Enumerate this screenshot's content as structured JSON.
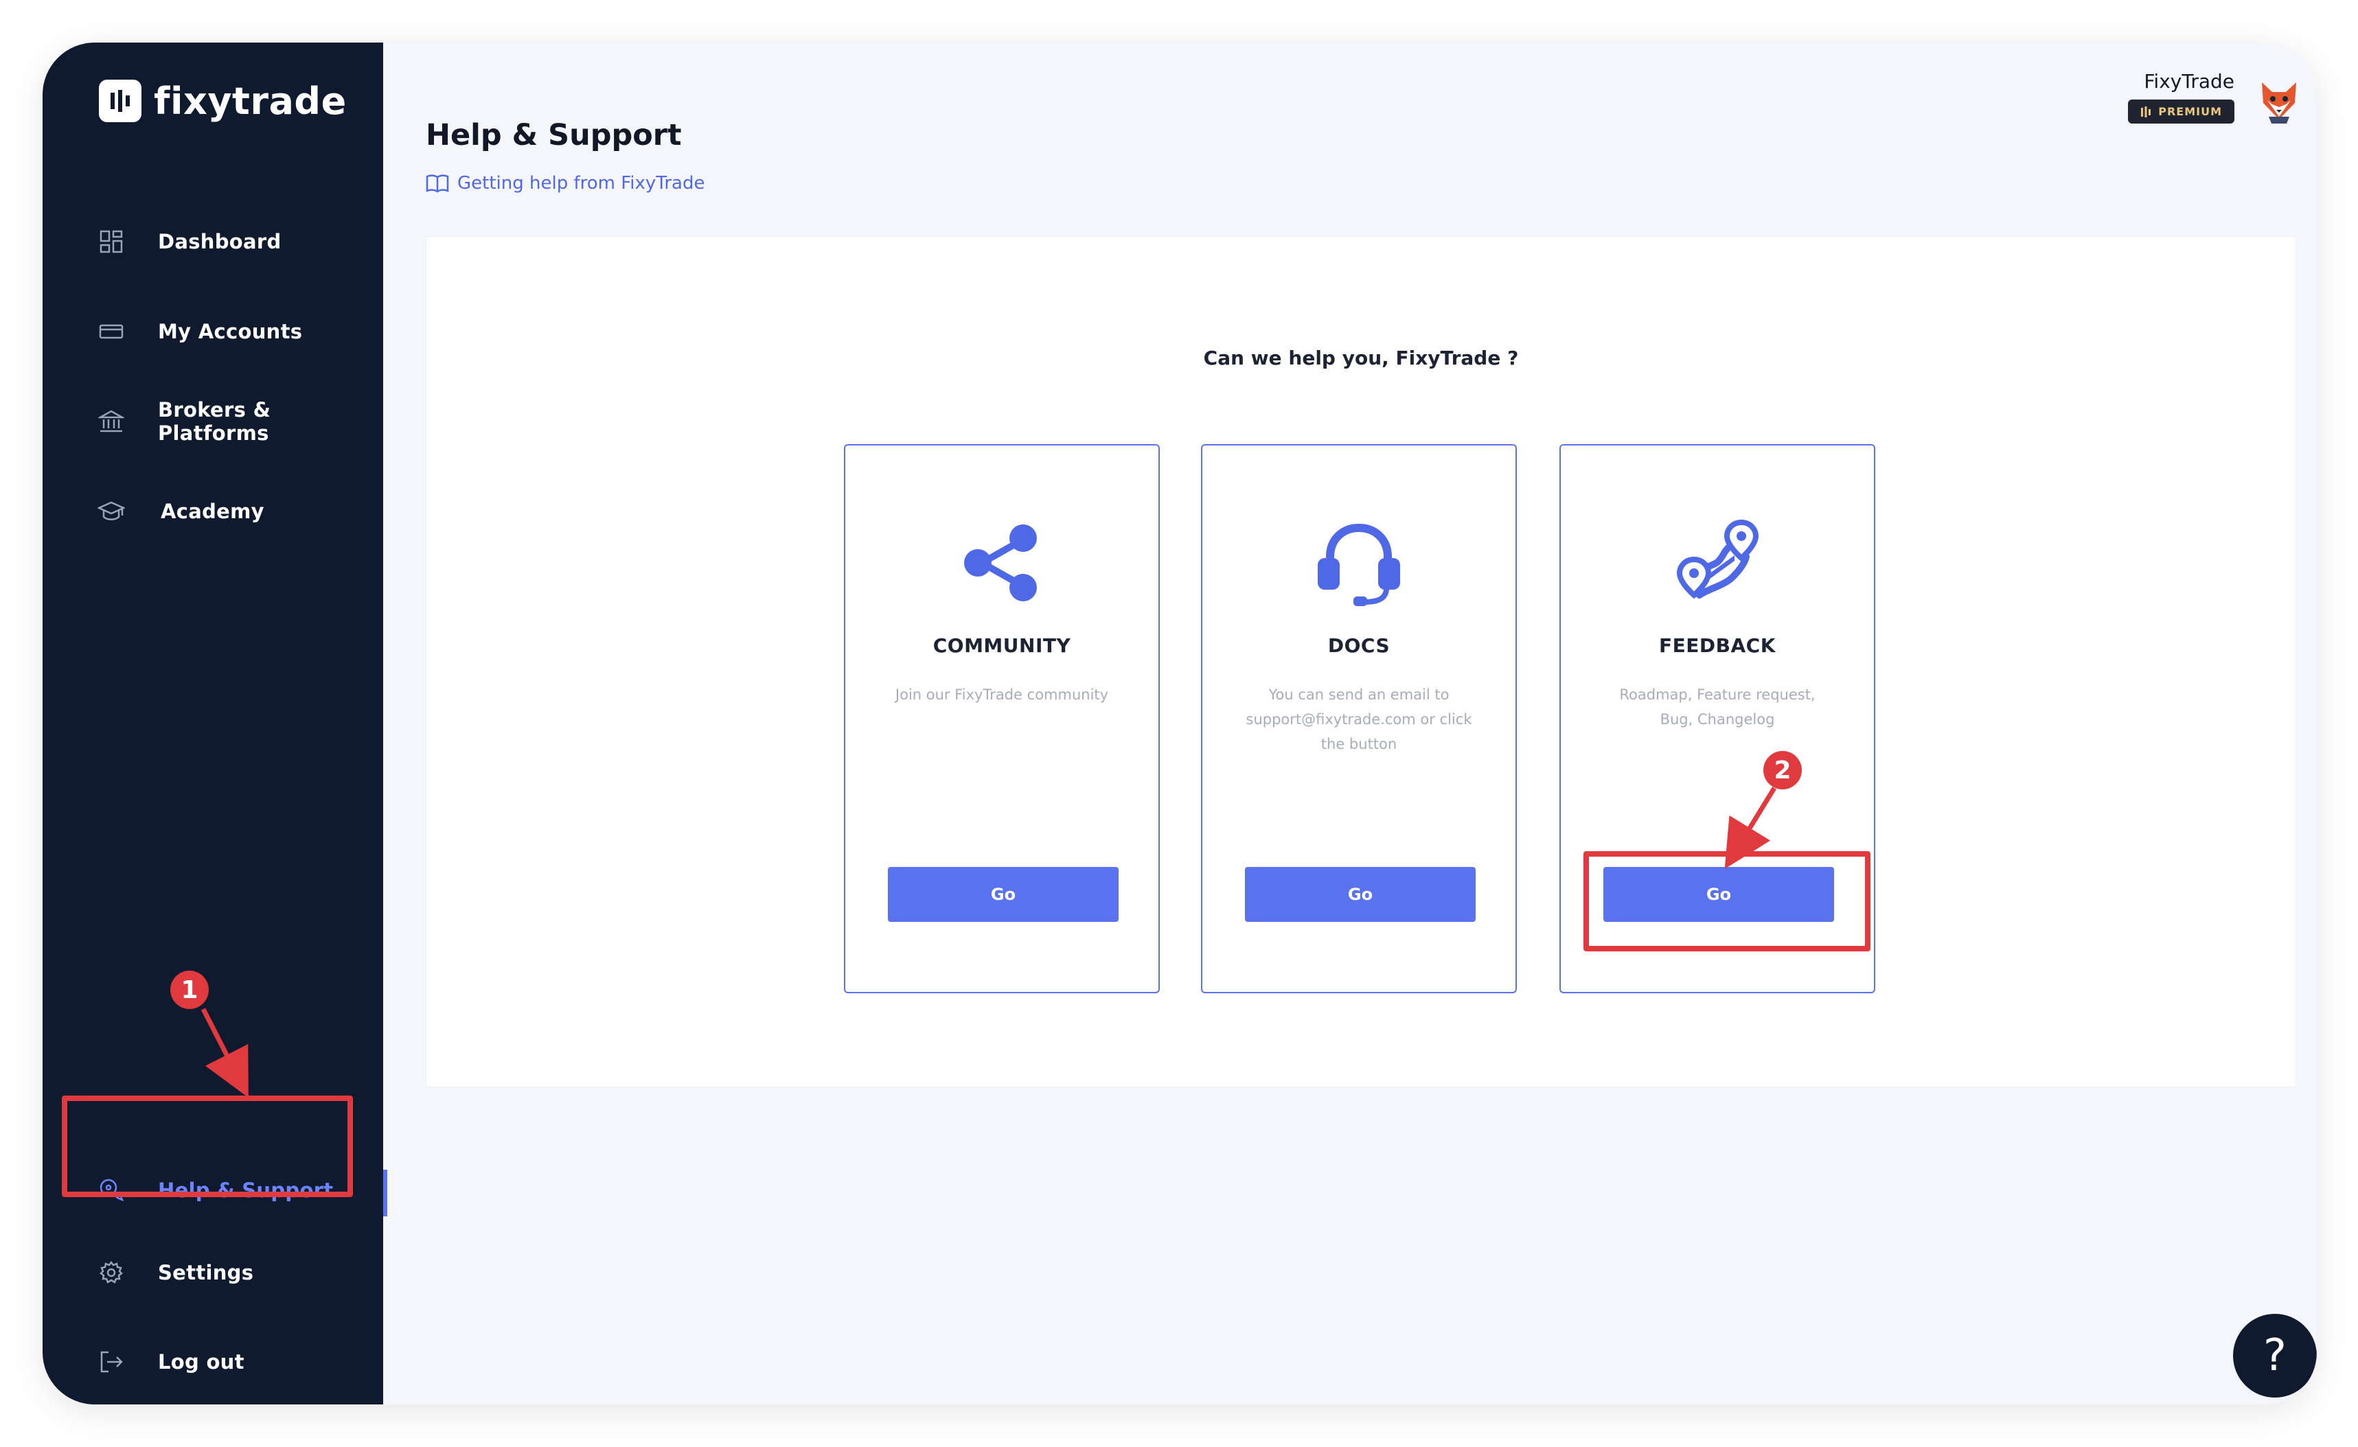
{
  "brand": {
    "name": "fixytrade"
  },
  "sidebar": {
    "items": [
      {
        "label": "Dashboard"
      },
      {
        "label": "My Accounts"
      },
      {
        "label": "Brokers & Platforms"
      },
      {
        "label": "Academy"
      },
      {
        "label": "Help & Support"
      },
      {
        "label": "Settings"
      },
      {
        "label": "Log out"
      }
    ]
  },
  "header": {
    "title": "Help & Support",
    "help_link": "Getting help from FixyTrade",
    "user_name": "FixyTrade",
    "badge": "PREMIUM"
  },
  "panel": {
    "heading": "Can we help you, FixyTrade ?",
    "cards": [
      {
        "title": "COMMUNITY",
        "description": "Join our FixyTrade community",
        "button": "Go",
        "icon": "share-icon"
      },
      {
        "title": "DOCS",
        "description": "You can send an email to support@fixytrade.com or click the button",
        "button": "Go",
        "icon": "headset-icon"
      },
      {
        "title": "FEEDBACK",
        "description": "Roadmap, Feature request, Bug, Changelog",
        "button": "Go",
        "icon": "roadmap-pins-icon"
      }
    ]
  },
  "annotations": [
    {
      "number": "1"
    },
    {
      "number": "2"
    }
  ],
  "fab": {
    "label": "?"
  },
  "colors": {
    "sidebar_bg": "#0f1a2e",
    "accent": "#5a72ee",
    "active_label": "#6b85ff",
    "annotation": "#e0393e",
    "premium_text": "#e9c77f"
  }
}
